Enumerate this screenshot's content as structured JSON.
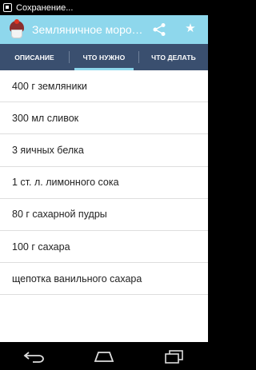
{
  "status_bar": {
    "notification_text": "Сохранение..."
  },
  "action_bar": {
    "title": "Земляничное морож..."
  },
  "tabs": [
    {
      "label": "ОПИСАНИЕ"
    },
    {
      "label": "ЧТО НУЖНО"
    },
    {
      "label": "ЧТО ДЕЛАТЬ"
    }
  ],
  "ingredients": [
    "400 г земляники",
    "300 мл сливок",
    "3 яичных белка",
    "1 ст. л. лимонного сока",
    "80 г сахарной пудры",
    "100 г сахара",
    "щепотка ванильного сахара"
  ],
  "colors": {
    "action_bar": "#8ed7ec",
    "tabs": "#3a4f6f",
    "tab_indicator": "#8ed7ec"
  },
  "icons": [
    "notification-icon",
    "app-icon",
    "share-icon",
    "star-icon",
    "back-icon",
    "home-icon",
    "recents-icon"
  ]
}
